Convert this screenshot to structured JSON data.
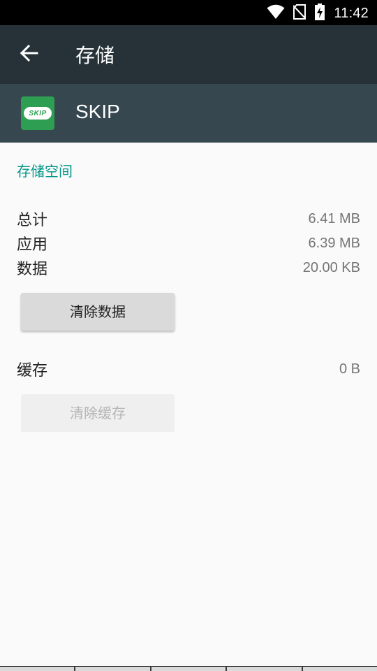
{
  "status_bar": {
    "time": "11:42",
    "icons": [
      "wifi-icon",
      "no-sim-icon",
      "battery-charging-icon"
    ]
  },
  "app_bar": {
    "back_icon": "back-arrow-icon",
    "title": "存储"
  },
  "app_header": {
    "icon": "skip-app-icon",
    "icon_text": "SKIP",
    "name": "SKIP"
  },
  "storage": {
    "section_title": "存储空间",
    "rows": [
      {
        "label": "总计",
        "value": "6.41 MB"
      },
      {
        "label": "应用",
        "value": "6.39 MB"
      },
      {
        "label": "数据",
        "value": "20.00 KB"
      }
    ],
    "clear_data_label": "清除数据",
    "cache": {
      "label": "缓存",
      "value": "0 B"
    },
    "clear_cache_label": "清除缓存"
  },
  "colors": {
    "status_bar": "#000000",
    "app_bar": "#263238",
    "app_header": "#37474f",
    "accent": "#009688",
    "app_icon": "#2e9f52"
  }
}
